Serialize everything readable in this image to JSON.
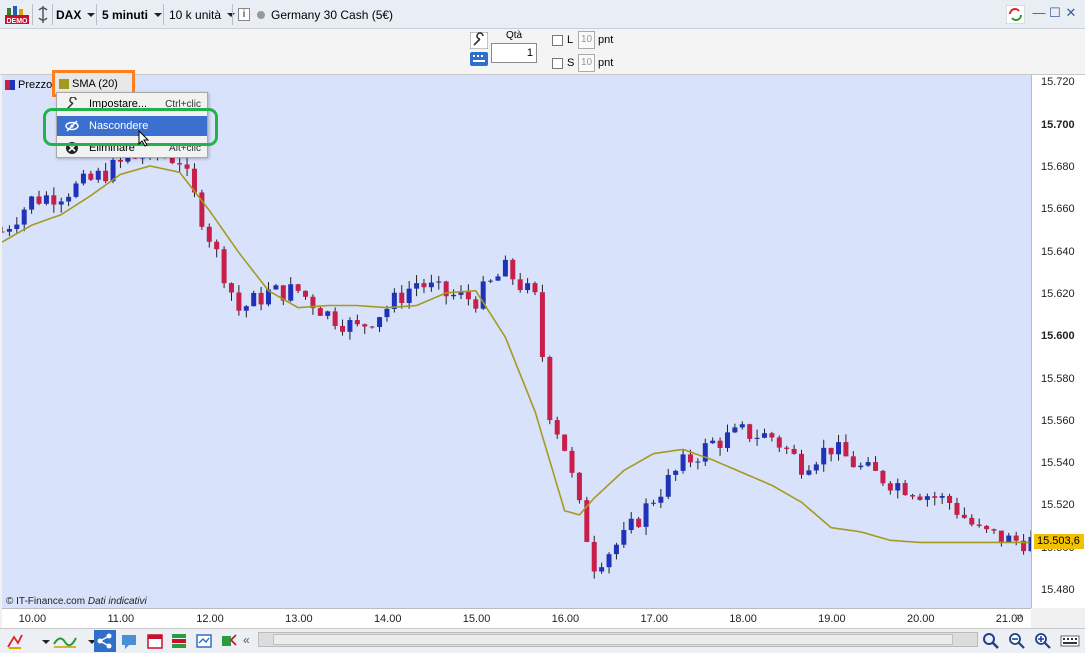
{
  "titlebar": {
    "demo_badge": "DEMO",
    "symbol": "DAX",
    "timeframe": "5 minuti",
    "units": "10 k unità",
    "info_icon": "i",
    "instrument": "Germany 30 Cash (5€)",
    "window_controls": [
      "—",
      "☐",
      "✕"
    ]
  },
  "order_toolbar": {
    "qty_label": "Qtà",
    "qty_value": "1",
    "limit_label": "L",
    "limit_value": "10",
    "limit_unit": "pnt",
    "stop_label": "S",
    "stop_value": "10",
    "stop_unit": "pnt"
  },
  "legend": {
    "price_label": "Prezzo",
    "sma_label": "SMA (20)"
  },
  "context_menu": {
    "items": [
      {
        "label": "Impostare...",
        "shortcut": "Ctrl+clic",
        "icon": "wrench-icon"
      },
      {
        "label": "Nascondere",
        "shortcut": "",
        "icon": "eye-hidden-icon"
      },
      {
        "label": "Eliminare",
        "shortcut": "Alt+clic",
        "icon": "delete-icon"
      }
    ]
  },
  "y_axis": {
    "labels": [
      "15.720",
      "15.700",
      "15.680",
      "15.660",
      "15.640",
      "15.620",
      "15.600",
      "15.580",
      "15.560",
      "15.540",
      "15.520",
      "15.500",
      "15.480"
    ],
    "major": [
      "15.700",
      "15.600"
    ]
  },
  "x_axis": {
    "labels": [
      "10.00",
      "11.00",
      "12.00",
      "13.00",
      "14.00",
      "15.00",
      "16.00",
      "17.00",
      "18.00",
      "19.00",
      "20.00",
      "21.00"
    ]
  },
  "current_price": "15.503,6",
  "copyright": {
    "source": "© IT-Finance.com",
    "note": "Dati indicativi"
  },
  "colors": {
    "up": "#1f33b8",
    "down": "#c81e4a",
    "sma": "#a59a20",
    "chart_bg": "#d8e2fa",
    "highlight_orange": "#ff7f1f",
    "highlight_green": "#22b24c",
    "menu_selected": "#3b6fd0",
    "price_tag": "#f2c200"
  },
  "chart_data": {
    "type": "candlestick",
    "title": "",
    "xlabel": "",
    "ylabel": "",
    "ylim": [
      15472,
      15724
    ],
    "x_range": [
      "09.40",
      "21.15"
    ],
    "timeframe": "5 minuti",
    "grid": false,
    "sma_period": 20,
    "last": 15503.6,
    "price_path": [
      [
        "09.40",
        15650
      ],
      [
        "10.00",
        15665
      ],
      [
        "10.20",
        15668
      ],
      [
        "10.40",
        15674
      ],
      [
        "11.00",
        15682
      ],
      [
        "11.20",
        15688
      ],
      [
        "11.40",
        15684
      ],
      [
        "12.00",
        15648
      ],
      [
        "12.20",
        15613
      ],
      [
        "12.40",
        15621
      ],
      [
        "13.00",
        15622
      ],
      [
        "13.20",
        15611
      ],
      [
        "13.40",
        15604
      ],
      [
        "14.00",
        15614
      ],
      [
        "14.20",
        15626
      ],
      [
        "14.40",
        15620
      ],
      [
        "15.00",
        15618
      ],
      [
        "15.20",
        15632
      ],
      [
        "15.40",
        15618
      ],
      [
        "15.50",
        15565
      ],
      [
        "16.00",
        15548
      ],
      [
        "16.10",
        15519
      ],
      [
        "16.20",
        15493
      ],
      [
        "16.40",
        15505
      ],
      [
        "17.00",
        15524
      ],
      [
        "17.20",
        15540
      ],
      [
        "17.40",
        15550
      ],
      [
        "18.00",
        15555
      ],
      [
        "18.20",
        15553
      ],
      [
        "18.40",
        15540
      ],
      [
        "19.00",
        15548
      ],
      [
        "19.20",
        15538
      ],
      [
        "19.40",
        15532
      ],
      [
        "20.00",
        15527
      ],
      [
        "20.20",
        15522
      ],
      [
        "20.40",
        15508
      ],
      [
        "21.00",
        15504
      ],
      [
        "21.15",
        15503.6
      ]
    ],
    "sma_path": [
      [
        "09.40",
        15645
      ],
      [
        "10.00",
        15653
      ],
      [
        "10.20",
        15658
      ],
      [
        "10.40",
        15667
      ],
      [
        "11.00",
        15677
      ],
      [
        "11.20",
        15681
      ],
      [
        "11.40",
        15678
      ],
      [
        "12.00",
        15660
      ],
      [
        "12.20",
        15640
      ],
      [
        "12.40",
        15622
      ],
      [
        "13.00",
        15614
      ],
      [
        "13.20",
        15615
      ],
      [
        "13.40",
        15615
      ],
      [
        "14.00",
        15614
      ],
      [
        "14.20",
        15615
      ],
      [
        "14.40",
        15621
      ],
      [
        "15.00",
        15622
      ],
      [
        "15.20",
        15600
      ],
      [
        "15.40",
        15565
      ],
      [
        "16.00",
        15518
      ],
      [
        "16.10",
        15516
      ],
      [
        "16.20",
        15524
      ],
      [
        "16.40",
        15537
      ],
      [
        "17.00",
        15545
      ],
      [
        "17.20",
        15547
      ],
      [
        "17.40",
        15542
      ],
      [
        "18.00",
        15536
      ],
      [
        "18.20",
        15530
      ],
      [
        "18.40",
        15522
      ],
      [
        "19.00",
        15510
      ],
      [
        "19.20",
        15508
      ],
      [
        "19.40",
        15504
      ],
      [
        "20.00",
        15503
      ],
      [
        "20.20",
        15503
      ],
      [
        "20.40",
        15503
      ],
      [
        "21.00",
        15503
      ],
      [
        "21.15",
        15503
      ]
    ]
  }
}
